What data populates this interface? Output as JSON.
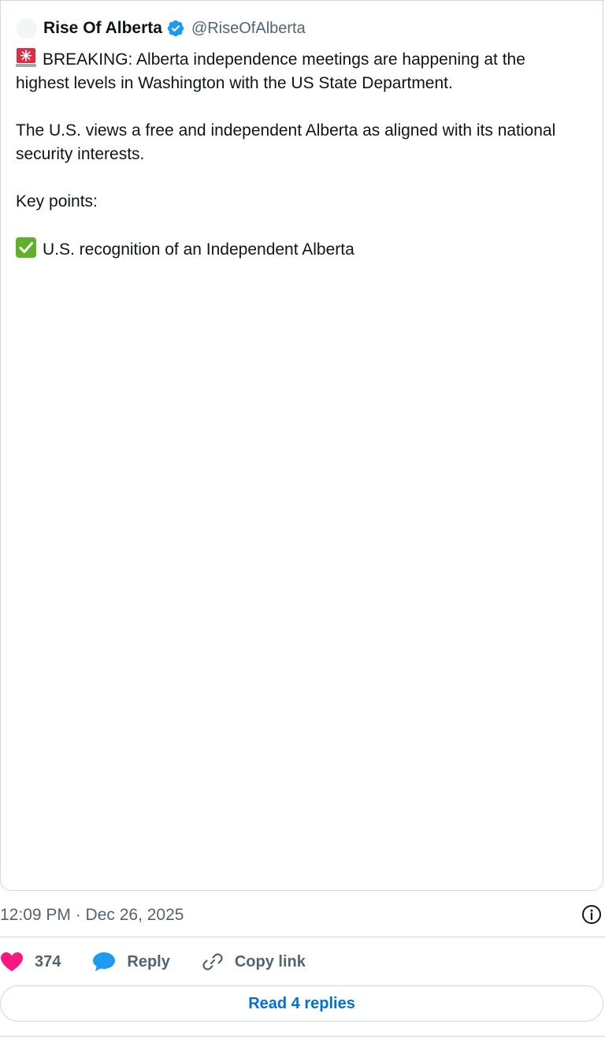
{
  "author": {
    "name": "Rise Of Alberta",
    "handle": "@RiseOfAlberta",
    "verified": true
  },
  "tweet": {
    "line1": "BREAKING: Alberta independence meetings are happening at the highest levels in Washington with the US State Department.",
    "line2": "The U.S. views a free and independent Alberta as aligned with its national security interests.",
    "line3": "Key points:",
    "line4": "U.S. recognition of an Independent Alberta",
    "emoji1": "rotating-light-icon",
    "emoji2": "check-mark-icon"
  },
  "meta": {
    "timestamp": "12:09 PM · Dec 26, 2025"
  },
  "actions": {
    "like_count": "374",
    "reply_label": "Reply",
    "copy_label": "Copy link"
  },
  "read_replies": "Read 4 replies",
  "colors": {
    "verified_blue": "#1d9bf0",
    "like_pink": "#f91880",
    "link_blue": "#006fd6",
    "check_green": "#5fb12b"
  }
}
